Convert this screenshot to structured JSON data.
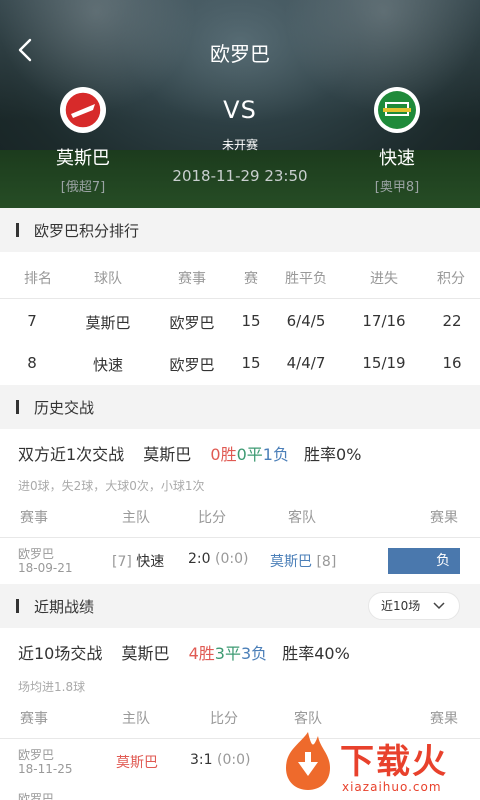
{
  "header": {
    "title": "欧罗巴",
    "vs": "VS",
    "status": "未开赛",
    "datetime": "2018-11-29 23:50",
    "home": {
      "name": "莫斯巴",
      "league": "[俄超7]",
      "logo_color": "#d72a2a"
    },
    "away": {
      "name": "快速",
      "league": "[奥甲8]",
      "logo_color": "#1f8a3a"
    }
  },
  "standings": {
    "title": "欧罗巴积分排行",
    "columns": [
      "排名",
      "球队",
      "赛事",
      "赛",
      "胜平负",
      "进失",
      "积分"
    ],
    "rows": [
      [
        "7",
        "莫斯巴",
        "欧罗巴",
        "15",
        "6/4/5",
        "17/16",
        "22"
      ],
      [
        "8",
        "快速",
        "欧罗巴",
        "15",
        "4/4/7",
        "15/19",
        "16"
      ]
    ]
  },
  "h2h": {
    "title": "历史交战",
    "summary": {
      "prefix": "双方近1次交战",
      "team": "莫斯巴",
      "win": "0胜",
      "draw": "0平",
      "loss": "1负",
      "rate": "胜率0%"
    },
    "note": "进0球，失2球，大球0次，小球1次",
    "columns": [
      "赛事",
      "主队",
      "比分",
      "客队",
      "赛果"
    ],
    "matches": [
      {
        "league": "欧罗巴",
        "date": "18-09-21",
        "home_rank": "[7]",
        "home": "快速",
        "score": "2:0",
        "half": "(0:0)",
        "away": "莫斯巴",
        "away_rank": "[8]",
        "result": "负"
      }
    ]
  },
  "recent": {
    "title": "近期战绩",
    "dropdown": "近10场",
    "summary": {
      "prefix": "近10场交战",
      "team": "莫斯巴",
      "win": "4胜",
      "draw": "3平",
      "loss": "3负",
      "rate": "胜率40%"
    },
    "note": "场均进1.8球",
    "columns": [
      "赛事",
      "主队",
      "比分",
      "客队",
      "赛果"
    ],
    "matches": [
      {
        "league": "欧罗巴",
        "date": "18-11-25",
        "home": "莫斯巴",
        "score": "3:1",
        "half": "(0:0)"
      }
    ],
    "next_row_league": "欧罗巴"
  },
  "watermark": {
    "text": "下载火",
    "url": "xiazaihuo.com"
  }
}
